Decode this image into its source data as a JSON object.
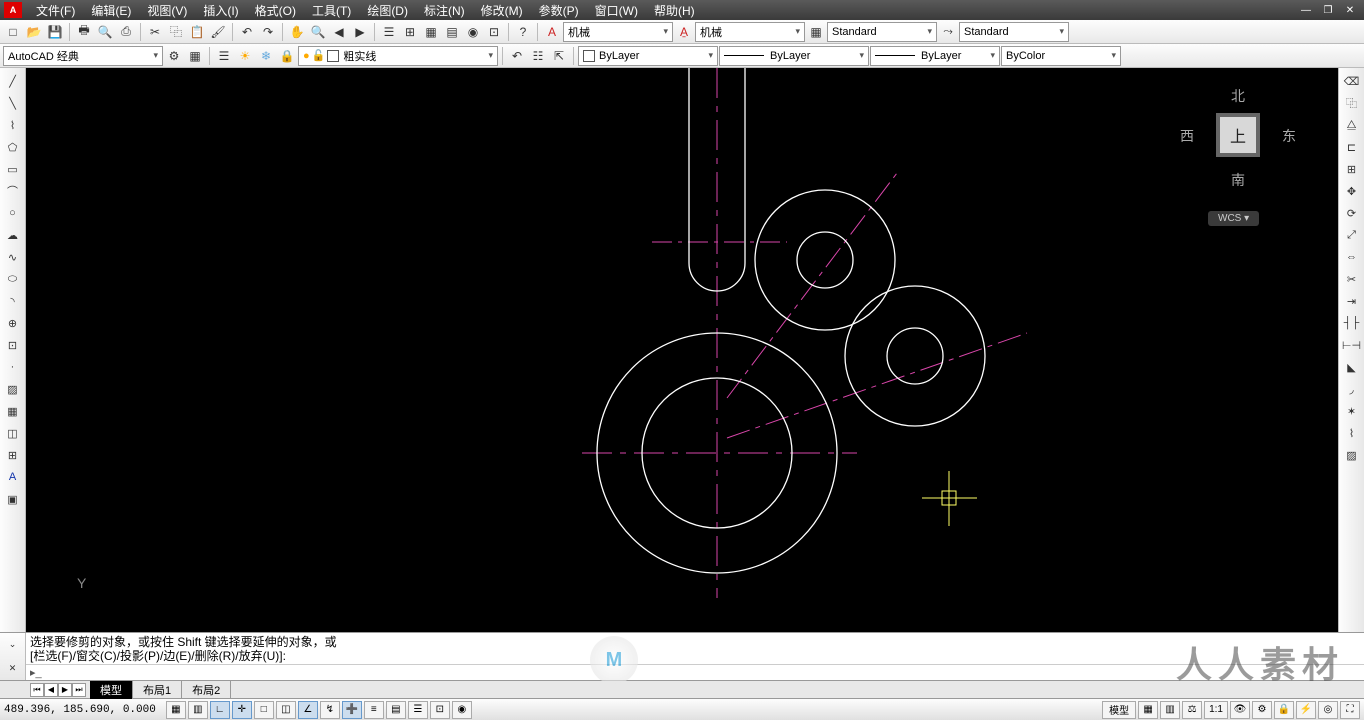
{
  "menu": {
    "items": [
      "文件(F)",
      "编辑(E)",
      "视图(V)",
      "插入(I)",
      "格式(O)",
      "工具(T)",
      "绘图(D)",
      "标注(N)",
      "修改(M)",
      "参数(P)",
      "窗口(W)",
      "帮助(H)"
    ]
  },
  "workspace": {
    "selected": "AutoCAD 经典"
  },
  "toolbar1": {
    "annot1_label": "机械",
    "annot2_label": "机械",
    "std1_label": "Standard",
    "std2_label": "Standard"
  },
  "toolbar2": {
    "linetype_label": "粗实线",
    "layer_label": "ByLayer",
    "linetype2_label": "ByLayer",
    "lineweight_label": "ByLayer",
    "color_label": "ByColor"
  },
  "viewcube": {
    "north": "北",
    "south": "南",
    "west": "西",
    "east": "东",
    "face": "上",
    "wcs": "WCS ▾"
  },
  "command": {
    "line1": "选择要修剪的对象，或按住 Shift 键选择要延伸的对象，或",
    "line2": "[栏选(F)/窗交(C)/投影(P)/边(E)/删除(R)/放弃(U)]:",
    "input_value": ""
  },
  "tabs": {
    "model": "模型",
    "layout1": "布局1",
    "layout2": "布局2"
  },
  "statusbar": {
    "coordinates": "489.396, 185.690, 0.000",
    "model_btn": "模型",
    "scale": "1:1"
  },
  "drawing": {
    "description": "Technical 2D part: two stacked concentric circles bottom-left, two smaller overlapping circle pairs upper-right, vertical slot at top, magenta centerlines (horizontal/vertical + two diagonals)"
  },
  "watermark_text": "人人素材"
}
